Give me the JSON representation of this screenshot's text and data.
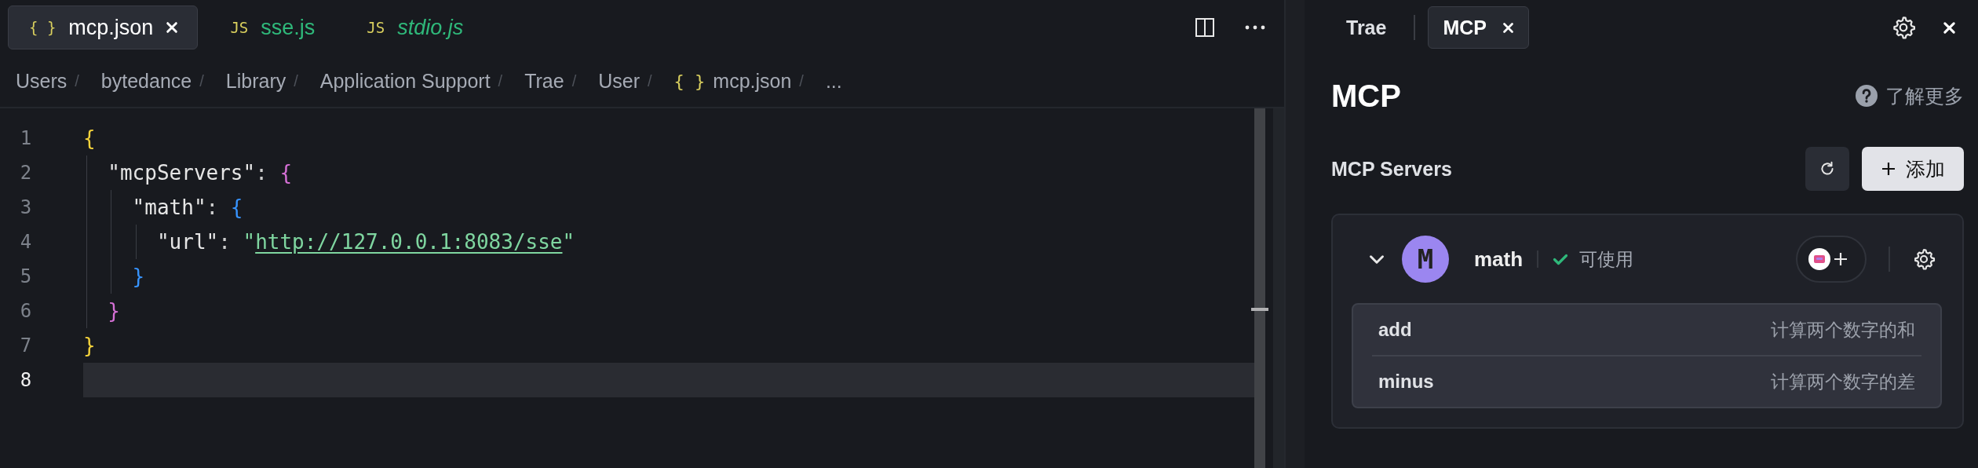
{
  "editor": {
    "tabs": [
      {
        "icon": "{ }",
        "label": "mcp.json",
        "selected": true,
        "preview": false,
        "untracked": false
      },
      {
        "icon": "JS",
        "label": "sse.js",
        "selected": false,
        "preview": false,
        "untracked": true
      },
      {
        "icon": "JS",
        "label": "stdio.js",
        "selected": false,
        "preview": true,
        "untracked": true
      }
    ],
    "breadcrumb": {
      "separator": "/",
      "items": [
        {
          "label": "Users"
        },
        {
          "label": "bytedance"
        },
        {
          "label": "Library"
        },
        {
          "label": "Application Support"
        },
        {
          "label": "Trae"
        },
        {
          "label": "User"
        },
        {
          "icon": "{ }",
          "label": "mcp.json"
        },
        {
          "label": "..."
        }
      ]
    },
    "lines": [
      {
        "number": "1",
        "current": false,
        "tokens": [
          {
            "kind": "bracket",
            "text": "{",
            "color": "#f5d33b"
          }
        ]
      },
      {
        "number": "2",
        "current": false,
        "tokens": [
          {
            "kind": "key",
            "text": "  \"mcpServers\""
          },
          {
            "kind": "punct",
            "text": ": "
          },
          {
            "kind": "bracket",
            "text": "{",
            "color": "#d670d6"
          }
        ]
      },
      {
        "number": "3",
        "current": false,
        "tokens": [
          {
            "kind": "key",
            "text": "    \"math\""
          },
          {
            "kind": "punct",
            "text": ": "
          },
          {
            "kind": "bracket",
            "text": "{",
            "color": "#3794ff"
          }
        ]
      },
      {
        "number": "4",
        "current": false,
        "tokens": [
          {
            "kind": "key",
            "text": "      \"url\""
          },
          {
            "kind": "punct",
            "text": ": "
          },
          {
            "kind": "string",
            "text": "\""
          },
          {
            "kind": "link",
            "text": "http://127.0.0.1:8083/sse"
          },
          {
            "kind": "string",
            "text": "\""
          }
        ]
      },
      {
        "number": "5",
        "current": false,
        "tokens": [
          {
            "kind": "bracket",
            "text": "    }",
            "color": "#3794ff"
          }
        ]
      },
      {
        "number": "6",
        "current": false,
        "tokens": [
          {
            "kind": "bracket",
            "text": "  }",
            "color": "#d670d6"
          }
        ]
      },
      {
        "number": "7",
        "current": false,
        "tokens": [
          {
            "kind": "bracket",
            "text": "}",
            "color": "#f5d33b"
          }
        ]
      },
      {
        "number": "8",
        "current": true
      }
    ]
  },
  "panel": {
    "tabs": [
      {
        "label": "Trae",
        "selected": false
      },
      {
        "label": "MCP",
        "selected": true
      }
    ],
    "title": "MCP",
    "help_link": "了解更多",
    "section_title": "MCP Servers",
    "add_button": "添加",
    "servers": [
      {
        "avatar": "M",
        "name": "math",
        "status": "可使用",
        "available": true,
        "expanded": true,
        "tools": [
          {
            "name": "add",
            "description": "计算两个数字的和"
          },
          {
            "name": "minus",
            "description": "计算两个数字的差"
          }
        ]
      }
    ]
  }
}
